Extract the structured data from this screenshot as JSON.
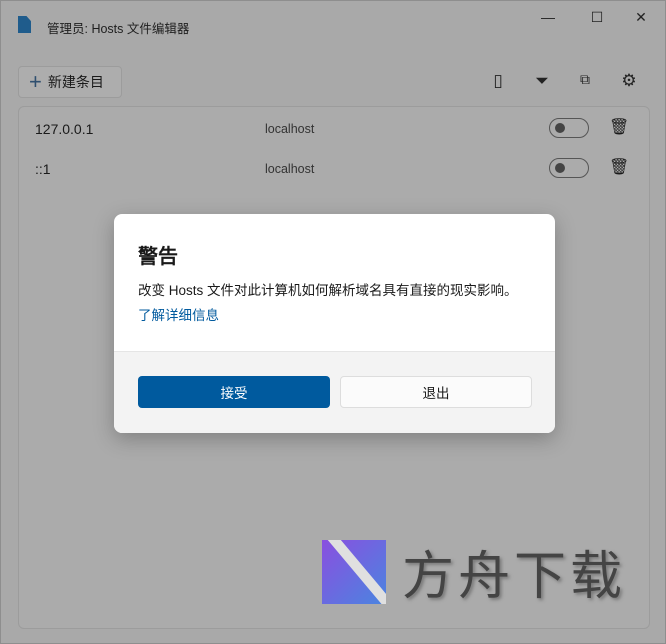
{
  "window": {
    "title": "管理员: Hosts 文件编辑器",
    "minimize": "—",
    "maximize": "☐",
    "close": "✕"
  },
  "toolbar": {
    "new_entry": "新建条目",
    "icons": [
      "file-icon",
      "filter-icon",
      "open-external-icon",
      "gear-icon"
    ]
  },
  "entries": [
    {
      "address": "127.0.0.1",
      "hosts": "localhost",
      "enabled": false
    },
    {
      "address": "::1",
      "hosts": "localhost",
      "enabled": false
    }
  ],
  "dialog": {
    "title": "警告",
    "message": "改变 Hosts 文件对此计算机如何解析域名具有直接的现实影响。",
    "link": "了解详细信息",
    "accept": "接受",
    "exit": "退出"
  },
  "watermark": {
    "text": "方舟下载"
  }
}
